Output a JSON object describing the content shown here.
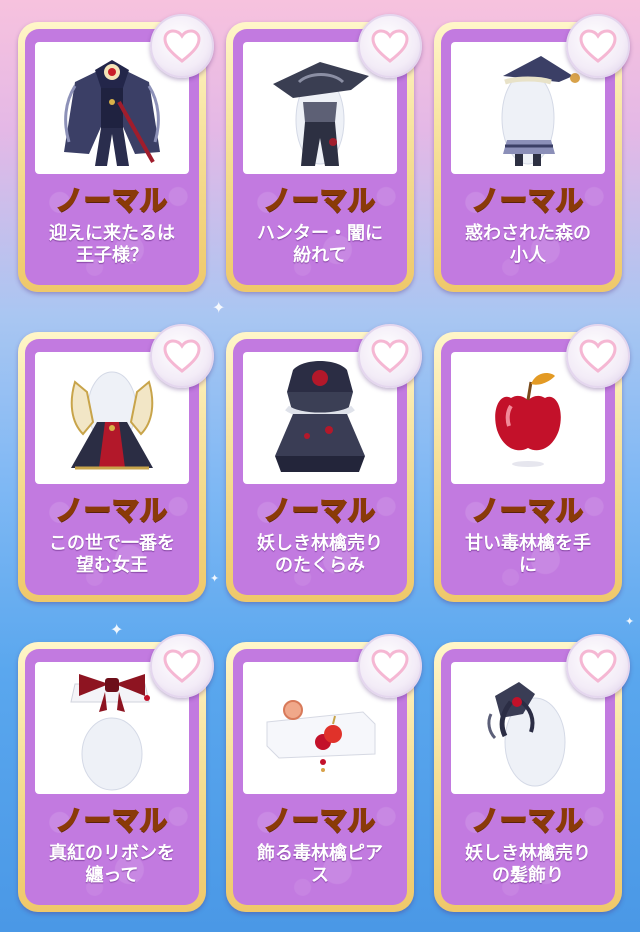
{
  "colors": {
    "card_purple": "#c27ae0",
    "card_gold": "#f3d98a",
    "rarity_text": "#ffe640",
    "heart_pink": "#f5b7d3"
  },
  "items": [
    {
      "rarity": "ノーマル",
      "name": "迎えに来たるは\n王子様？",
      "icon": "prince-outfit-icon",
      "favorite_icon": "heart-icon"
    },
    {
      "rarity": "ノーマル",
      "name": "ハンター・闇に\n紛れて",
      "icon": "hunter-hat-icon",
      "favorite_icon": "heart-icon"
    },
    {
      "rarity": "ノーマル",
      "name": "惑わされた森の\n小人",
      "icon": "dwarf-outfit-icon",
      "favorite_icon": "heart-icon"
    },
    {
      "rarity": "ノーマル",
      "name": "この世で一番を\n望む女王",
      "icon": "queen-dress-icon",
      "favorite_icon": "heart-icon"
    },
    {
      "rarity": "ノーマル",
      "name": "妖しき林檎売り\nのたくらみ",
      "icon": "apple-seller-dress-icon",
      "favorite_icon": "heart-icon"
    },
    {
      "rarity": "ノーマル",
      "name": "甘い毒林檎を手\nに",
      "icon": "red-apple-icon",
      "favorite_icon": "heart-icon"
    },
    {
      "rarity": "ノーマル",
      "name": "真紅のリボンを\n纏って",
      "icon": "red-ribbon-icon",
      "favorite_icon": "heart-icon"
    },
    {
      "rarity": "ノーマル",
      "name": "飾る毒林檎ピア\nス",
      "icon": "apple-earrings-icon",
      "favorite_icon": "heart-icon"
    },
    {
      "rarity": "ノーマル",
      "name": "妖しき林檎売り\nの髪飾り",
      "icon": "hair-ornament-icon",
      "favorite_icon": "heart-icon"
    }
  ]
}
